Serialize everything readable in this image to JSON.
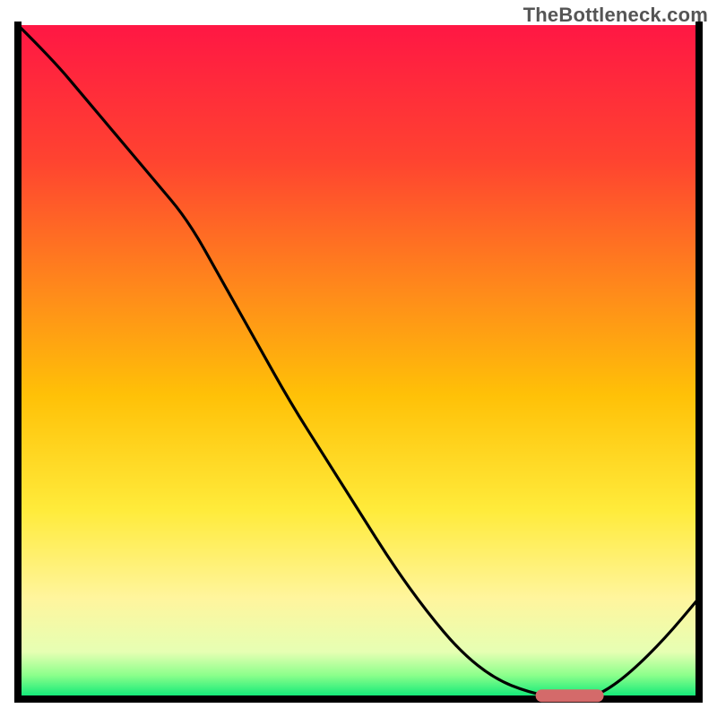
{
  "watermark": "TheBottleneck.com",
  "chart_data": {
    "type": "line",
    "title": "",
    "xlabel": "",
    "ylabel": "",
    "xlim": [
      0,
      100
    ],
    "ylim": [
      0,
      100
    ],
    "series": [
      {
        "name": "curve",
        "x": [
          0,
          5,
          10,
          15,
          20,
          25,
          30,
          35,
          40,
          45,
          50,
          55,
          60,
          65,
          70,
          75,
          80,
          83,
          86,
          90,
          95,
          100
        ],
        "values": [
          100,
          95,
          89,
          83,
          77,
          71,
          62,
          53,
          44,
          36,
          28,
          20,
          13,
          7,
          3,
          1,
          0,
          0,
          1,
          4,
          9,
          15
        ]
      }
    ],
    "optimal_band": {
      "x_start": 76,
      "x_end": 86,
      "y": 0.5
    },
    "gradient_stops": [
      {
        "offset": 0.0,
        "color": "#ff1744"
      },
      {
        "offset": 0.2,
        "color": "#ff4330"
      },
      {
        "offset": 0.4,
        "color": "#ff8c1a"
      },
      {
        "offset": 0.55,
        "color": "#ffc107"
      },
      {
        "offset": 0.72,
        "color": "#ffeb3b"
      },
      {
        "offset": 0.85,
        "color": "#fff59d"
      },
      {
        "offset": 0.93,
        "color": "#e6ffb3"
      },
      {
        "offset": 0.965,
        "color": "#8bff8b"
      },
      {
        "offset": 1.0,
        "color": "#00e676"
      }
    ],
    "axes": {
      "left": {
        "x0": 2,
        "y0": 2,
        "x1": 2,
        "y1": 98
      },
      "bottom": {
        "x0": 2,
        "y0": 98,
        "x1": 98,
        "y1": 98
      },
      "right": {
        "x0": 98,
        "y0": 2,
        "x1": 98,
        "y1": 98
      }
    }
  }
}
